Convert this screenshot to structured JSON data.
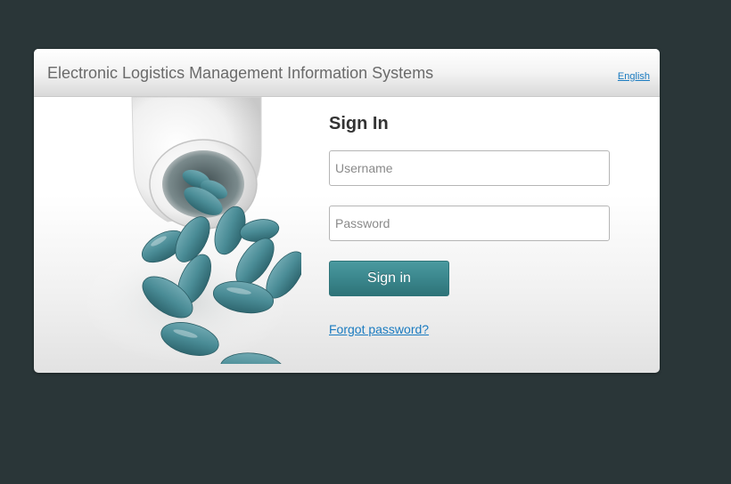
{
  "header": {
    "title": "Electronic Logistics Management Information Systems",
    "language": "English"
  },
  "form": {
    "heading": "Sign In",
    "username_placeholder": "Username",
    "password_placeholder": "Password",
    "submit_label": "Sign in",
    "forgot_label": "Forgot password?"
  },
  "illustration": {
    "icon": "pill-bottle-icon"
  },
  "colors": {
    "page_background": "#2a3638",
    "button": "#3b878d",
    "link": "#1a7bc0",
    "pill": "#4a8c96"
  }
}
